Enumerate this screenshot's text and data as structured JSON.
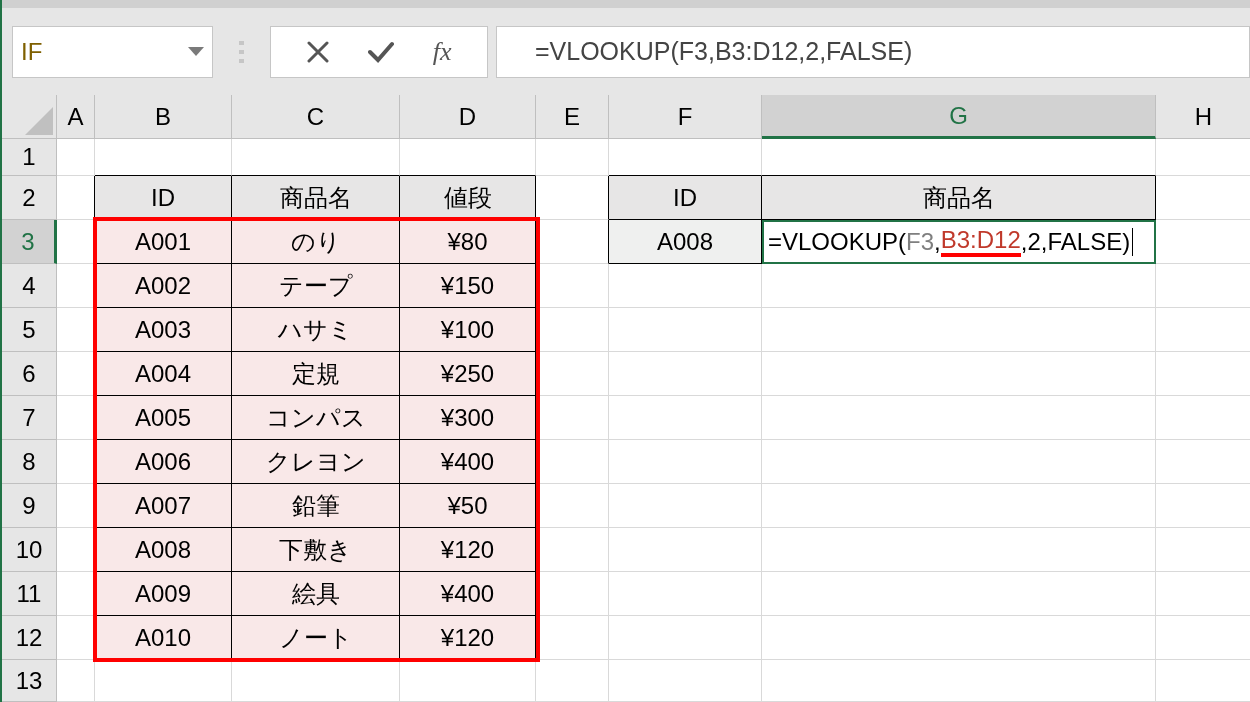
{
  "name_box": {
    "value": "IF"
  },
  "formula_bar": {
    "function_label": "fx",
    "formula": "=VLOOKUP(F3,B3:D12,2,FALSE)"
  },
  "column_headers": [
    {
      "label": "A",
      "selected": false
    },
    {
      "label": "B",
      "selected": false
    },
    {
      "label": "C",
      "selected": false
    },
    {
      "label": "D",
      "selected": false
    },
    {
      "label": "E",
      "selected": false
    },
    {
      "label": "F",
      "selected": false
    },
    {
      "label": "G",
      "selected": true
    },
    {
      "label": "H",
      "selected": false
    }
  ],
  "row_headers": [
    {
      "label": "1",
      "selected": false
    },
    {
      "label": "2",
      "selected": false
    },
    {
      "label": "3",
      "selected": true
    },
    {
      "label": "4",
      "selected": false
    },
    {
      "label": "5",
      "selected": false
    },
    {
      "label": "6",
      "selected": false
    },
    {
      "label": "7",
      "selected": false
    },
    {
      "label": "8",
      "selected": false
    },
    {
      "label": "9",
      "selected": false
    },
    {
      "label": "10",
      "selected": false
    },
    {
      "label": "11",
      "selected": false
    },
    {
      "label": "12",
      "selected": false
    },
    {
      "label": "13",
      "selected": false
    }
  ],
  "product_table": {
    "columns": [
      "ID",
      "商品名",
      "値段"
    ],
    "highlighted": true,
    "rows": [
      [
        "A001",
        "のり",
        "¥80"
      ],
      [
        "A002",
        "テープ",
        "¥150"
      ],
      [
        "A003",
        "ハサミ",
        "¥100"
      ],
      [
        "A004",
        "定規",
        "¥250"
      ],
      [
        "A005",
        "コンパス",
        "¥300"
      ],
      [
        "A006",
        "クレヨン",
        "¥400"
      ],
      [
        "A007",
        "鉛筆",
        "¥50"
      ],
      [
        "A008",
        "下敷き",
        "¥120"
      ],
      [
        "A009",
        "絵具",
        "¥400"
      ],
      [
        "A010",
        "ノート",
        "¥120"
      ]
    ]
  },
  "lookup_table": {
    "columns": [
      "ID",
      "商品名"
    ],
    "id_value": "A008",
    "editing": true,
    "formula_segments": [
      {
        "text": "=VLOOKUP(",
        "kind": "plain"
      },
      {
        "text": "F3",
        "kind": "ref",
        "color": "#7f7f7f",
        "underlined": false
      },
      {
        "text": ",",
        "kind": "plain"
      },
      {
        "text": "B3:D12",
        "kind": "ref",
        "color": "#c0392b",
        "underlined": true
      },
      {
        "text": ",2,FALSE)",
        "kind": "plain"
      }
    ]
  }
}
